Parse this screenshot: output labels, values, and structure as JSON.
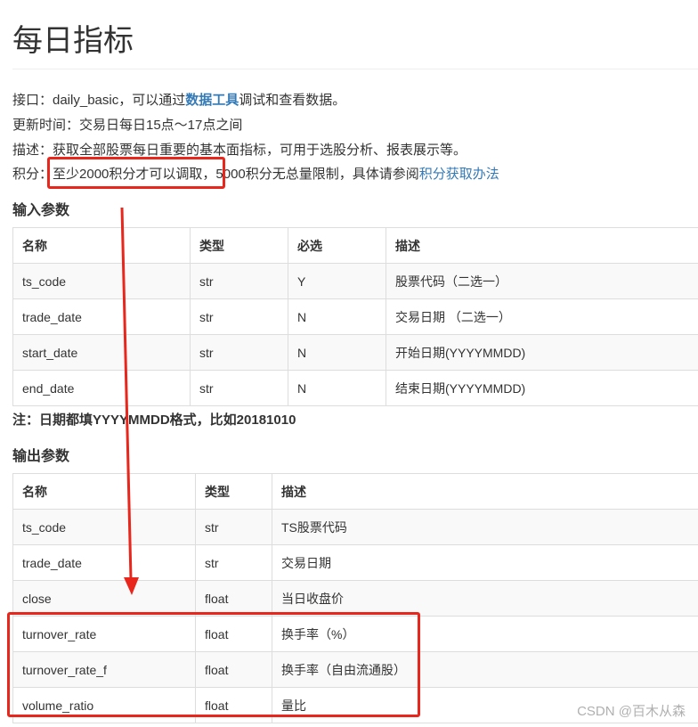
{
  "page": {
    "title": "每日指标"
  },
  "info": {
    "interface_prefix": "接口：daily_basic，可以通过",
    "interface_link": "数据工具",
    "interface_suffix": "调试和查看数据。",
    "update_time": "更新时间：交易日每日15点～17点之间",
    "description": "描述：获取全部股票每日重要的基本面指标，可用于选股分析、报表展示等。",
    "points_label": "积分：",
    "points_highlight": "至少2000积分才可以调取，",
    "points_rest": "5000积分无总量限制，具体请参阅",
    "points_link": "积分获取办法"
  },
  "input_section": {
    "heading": "输入参数",
    "headers": [
      "名称",
      "类型",
      "必选",
      "描述"
    ],
    "rows": [
      [
        "ts_code",
        "str",
        "Y",
        "股票代码（二选一）"
      ],
      [
        "trade_date",
        "str",
        "N",
        "交易日期 （二选一）"
      ],
      [
        "start_date",
        "str",
        "N",
        "开始日期(YYYYMMDD)"
      ],
      [
        "end_date",
        "str",
        "N",
        "结束日期(YYYYMMDD)"
      ]
    ]
  },
  "note": "注：日期都填YYYYMMDD格式，比如20181010",
  "output_section": {
    "heading": "输出参数",
    "headers": [
      "名称",
      "类型",
      "描述"
    ],
    "rows": [
      [
        "ts_code",
        "str",
        "TS股票代码"
      ],
      [
        "trade_date",
        "str",
        "交易日期"
      ],
      [
        "close",
        "float",
        "当日收盘价"
      ],
      [
        "turnover_rate",
        "float",
        "换手率（%）"
      ],
      [
        "turnover_rate_f",
        "float",
        "换手率（自由流通股）"
      ],
      [
        "volume_ratio",
        "float",
        "量比"
      ]
    ]
  },
  "watermark": "CSDN @百木从森",
  "annotation_color": "#e8261c"
}
